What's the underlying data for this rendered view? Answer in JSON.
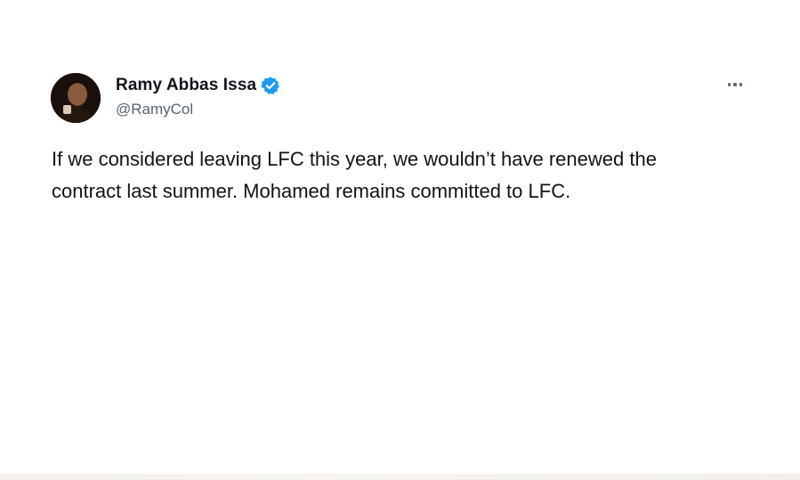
{
  "tweet": {
    "author": {
      "display_name": "Ramy Abbas Issa",
      "handle": "@RamyCol",
      "verified": true,
      "verified_color": "#1d9bf0"
    },
    "text": "If we considered leaving LFC this year, we wouldn’t have renewed the\ncontract last summer. Mohamed remains committed to LFC.",
    "more_icon": "more-horizontal-icon"
  }
}
